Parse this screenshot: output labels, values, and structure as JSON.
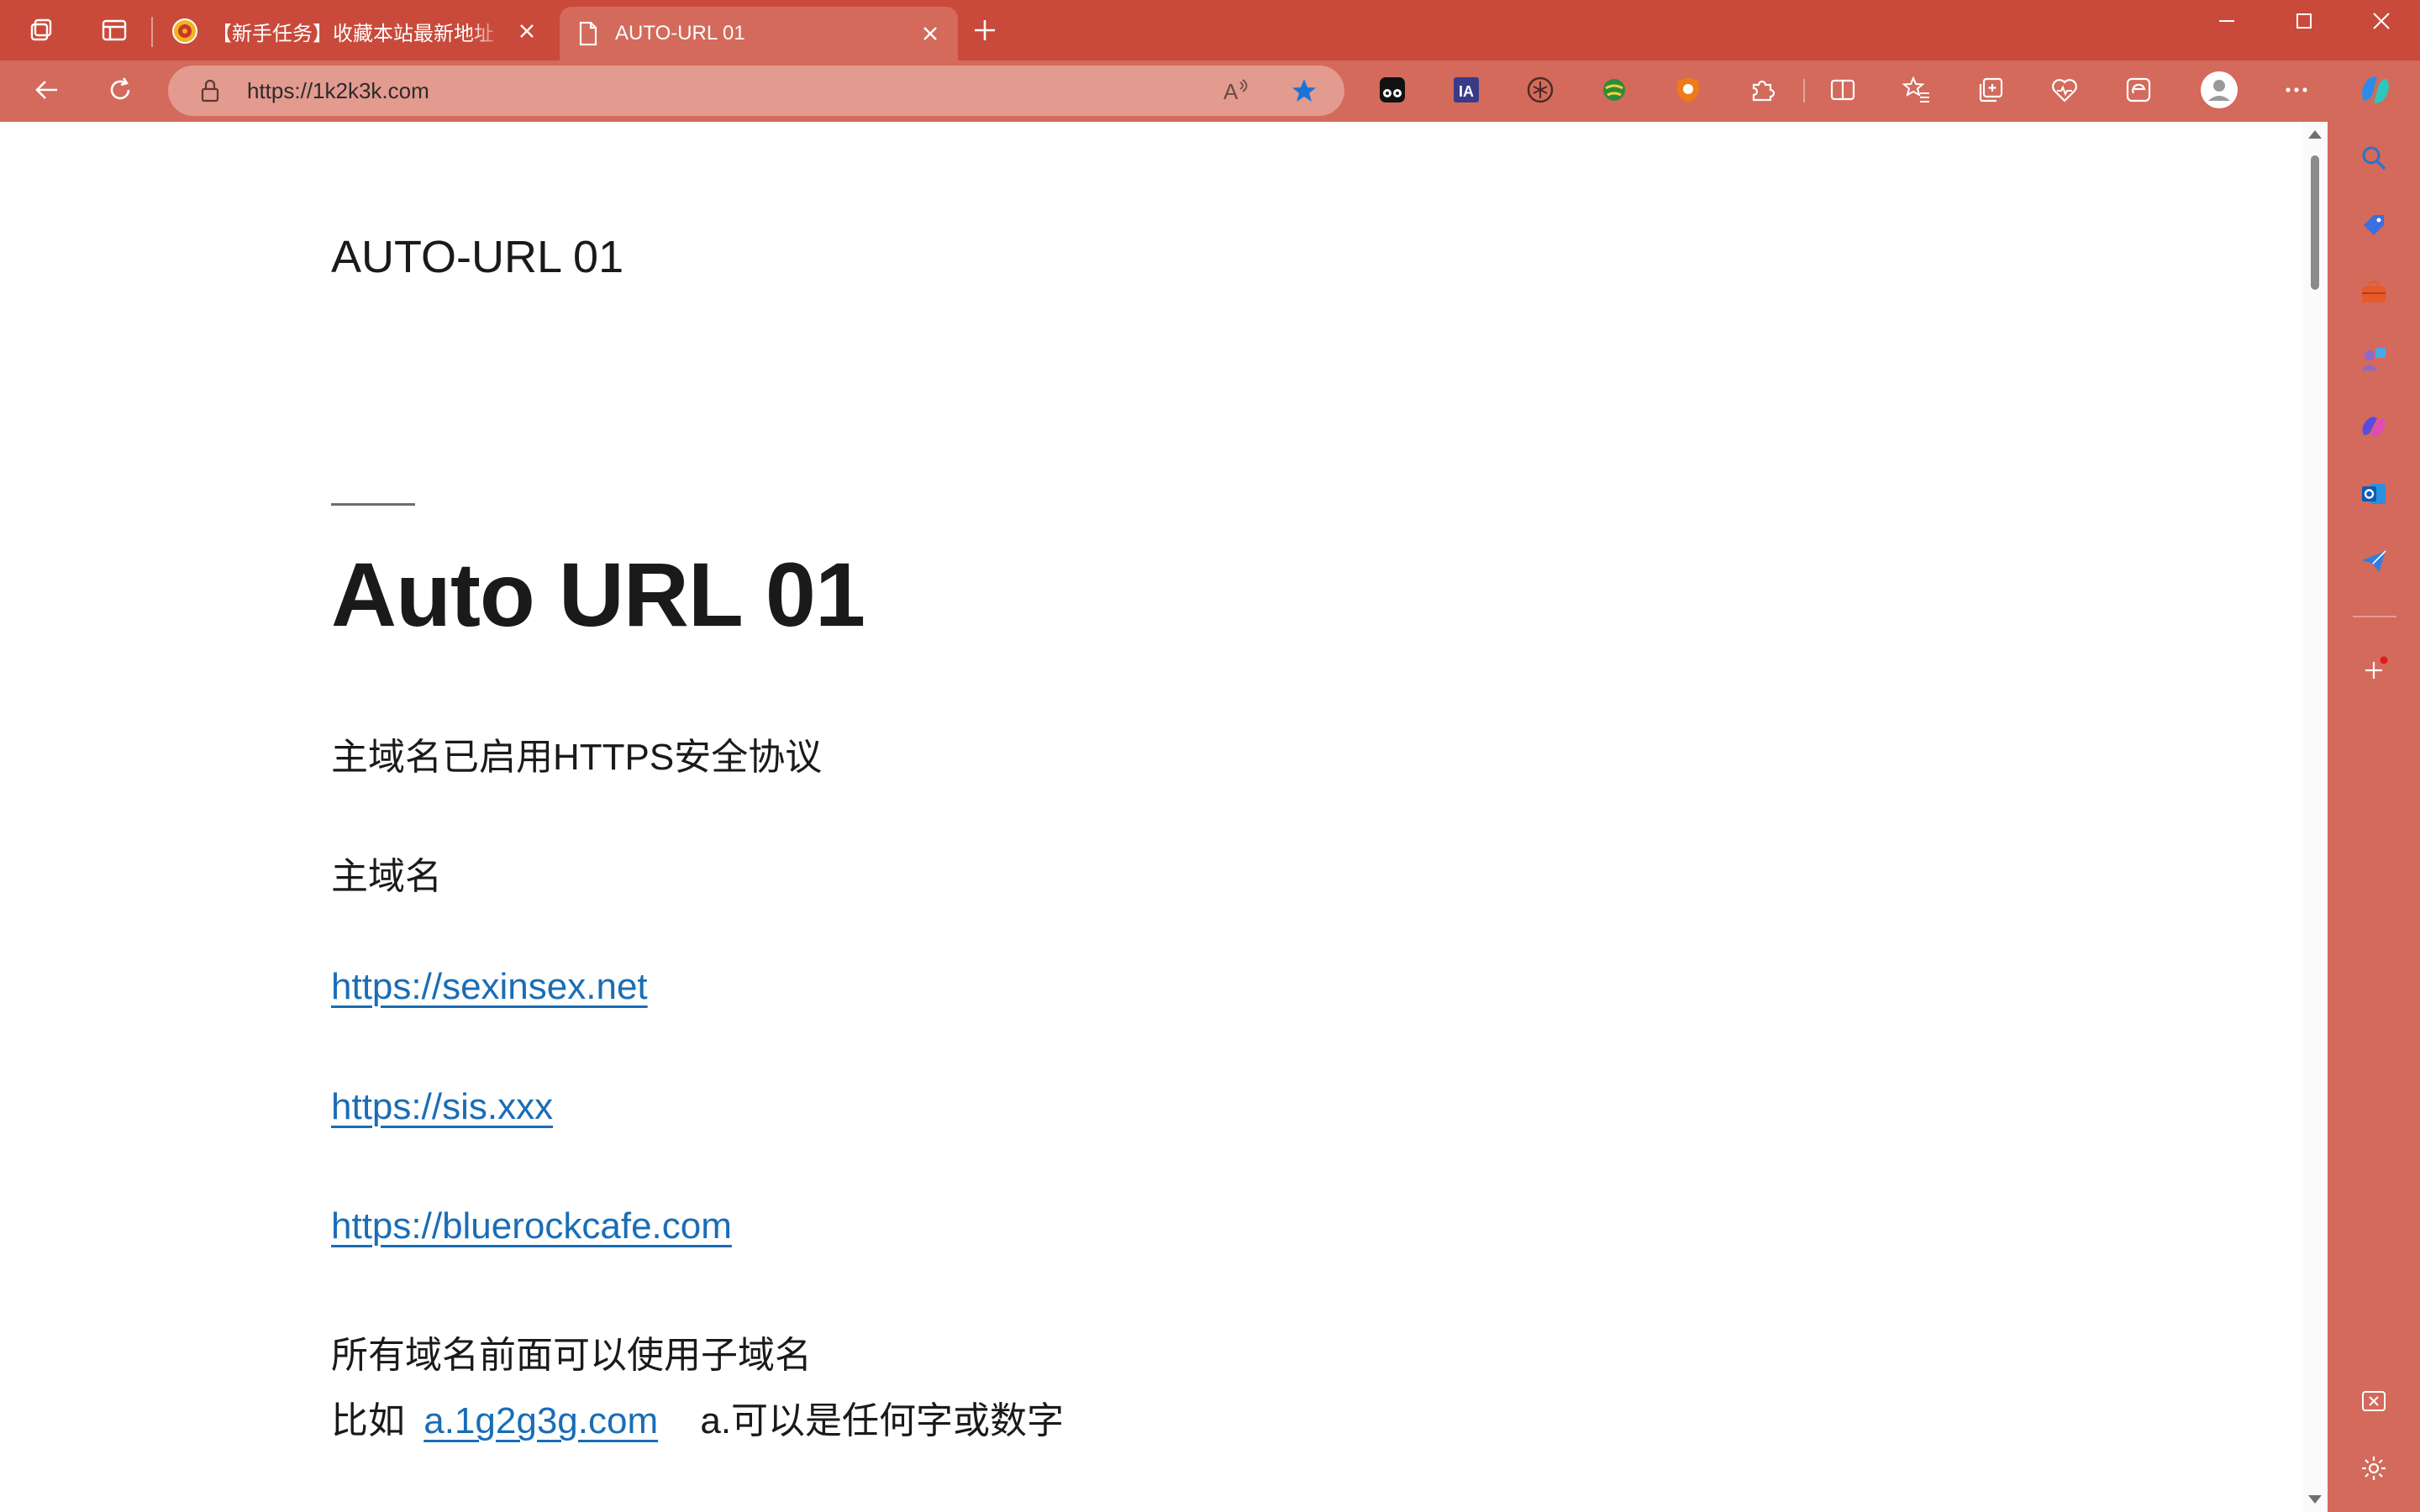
{
  "browser": {
    "tabs": [
      {
        "title": "【新手任务】收藏本站最新地址",
        "active": false,
        "icon": "seal-icon"
      },
      {
        "title": "AUTO-URL 01",
        "active": true,
        "icon": "page-icon"
      }
    ],
    "address": {
      "url": "https://1k2k3k.com"
    },
    "colors": {
      "frame": "#c94a3b",
      "toolbar": "#d36a5b",
      "address": "#e39a8f",
      "link": "#1a6db5"
    }
  },
  "page": {
    "site_title": "AUTO-URL 01",
    "heading": "Auto URL 01",
    "https_note": "主域名已启用HTTPS安全协议",
    "main_domain_label": "主域名",
    "links": [
      "https://sexinsex.net",
      "https://sis.xxx",
      "https://bluerockcafe.com"
    ],
    "subdomain_note": "所有域名前面可以使用子域名",
    "example_prefix": "比如",
    "example_link": "a.1g2g3g.com",
    "example_suffix": "a.可以是任何字或数字"
  }
}
